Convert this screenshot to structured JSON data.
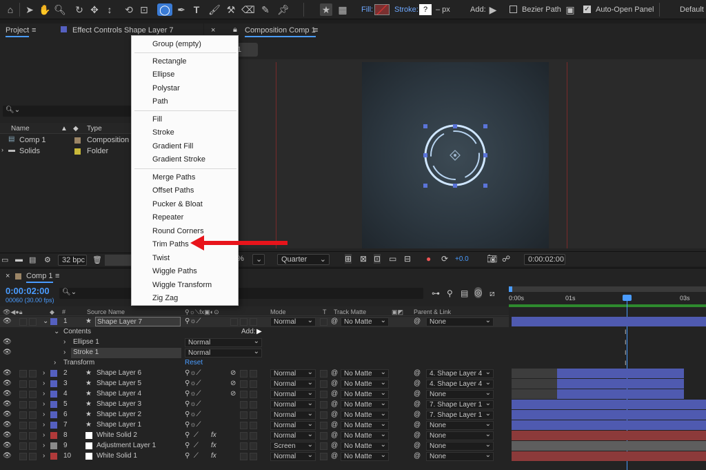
{
  "toolbar": {
    "fill_label": "Fill:",
    "stroke_label": "Stroke:",
    "stroke_value": "?",
    "stroke_unit": "– px",
    "add_label": "Add:",
    "bezier_label": "Bezier Path",
    "auto_open_label": "Auto-Open Panel",
    "workspace": "Default"
  },
  "project": {
    "tab_project": "Project",
    "tab_effects": "Effect Controls Shape Layer 7",
    "col_name": "Name",
    "col_type": "Type",
    "items": [
      {
        "name": "Comp 1",
        "type": "Composition",
        "color": "#9b8566"
      },
      {
        "name": "Solids",
        "type": "Folder",
        "color": "#c9b93a"
      }
    ],
    "bpc": "32 bpc"
  },
  "viewer": {
    "tab": "Composition Comp 1",
    "subtab": "1",
    "zoom": "%",
    "resolution": "Quarter",
    "exposure": "+0.0",
    "timecode": "0:00:02:00"
  },
  "timeline": {
    "tab": "Comp 1",
    "timecode": "0:00:02:00",
    "fps": "00060 (30.00 fps)",
    "headers": {
      "num": "#",
      "source": "Source Name",
      "mode": "Mode",
      "t": "T",
      "track_matte": "Track Matte",
      "parent": "Parent & Link"
    },
    "ruler": [
      "0:00s",
      "01s",
      "03s"
    ],
    "contents_label": "Contents",
    "add_label": "Add:",
    "transform_label": "Transform",
    "reset_label": "Reset",
    "sub_rows": [
      {
        "name": "Ellipse 1",
        "mode": "Normal"
      },
      {
        "name": "Stroke 1",
        "mode": "Normal"
      }
    ],
    "layers": [
      {
        "num": "1",
        "name": "Shape Layer 7",
        "mode": "Normal",
        "matte": "No Matte",
        "parent": "None",
        "color": "#5560c0"
      },
      {
        "num": "2",
        "name": "Shape Layer 6",
        "mode": "Normal",
        "matte": "No Matte",
        "parent": "4. Shape Layer 4",
        "color": "#5560c0"
      },
      {
        "num": "3",
        "name": "Shape Layer 5",
        "mode": "Normal",
        "matte": "No Matte",
        "parent": "4. Shape Layer 4",
        "color": "#5560c0"
      },
      {
        "num": "4",
        "name": "Shape Layer 4",
        "mode": "Normal",
        "matte": "No Matte",
        "parent": "None",
        "color": "#5560c0"
      },
      {
        "num": "5",
        "name": "Shape Layer 3",
        "mode": "Normal",
        "matte": "No Matte",
        "parent": "7. Shape Layer 1",
        "color": "#5560c0"
      },
      {
        "num": "6",
        "name": "Shape Layer 2",
        "mode": "Normal",
        "matte": "No Matte",
        "parent": "7. Shape Layer 1",
        "color": "#5560c0"
      },
      {
        "num": "7",
        "name": "Shape Layer 1",
        "mode": "Normal",
        "matte": "No Matte",
        "parent": "None",
        "color": "#5560c0"
      },
      {
        "num": "8",
        "name": "White Solid 2",
        "mode": "Normal",
        "matte": "No Matte",
        "parent": "None",
        "color": "#b03a3a"
      },
      {
        "num": "9",
        "name": "Adjustment Layer 1",
        "mode": "Screen",
        "matte": "No Matte",
        "parent": "None",
        "color": "#8a8a8a"
      },
      {
        "num": "10",
        "name": "White Solid 1",
        "mode": "Normal",
        "matte": "No Matte",
        "parent": "None",
        "color": "#b03a3a"
      }
    ]
  },
  "menu": {
    "items": [
      "Group (empty)",
      "Rectangle",
      "Ellipse",
      "Polystar",
      "Path",
      "Fill",
      "Stroke",
      "Gradient Fill",
      "Gradient Stroke",
      "Merge Paths",
      "Offset Paths",
      "Pucker & Bloat",
      "Repeater",
      "Round Corners",
      "Trim Paths",
      "Twist",
      "Wiggle Paths",
      "Wiggle Transform",
      "Zig Zag"
    ]
  }
}
